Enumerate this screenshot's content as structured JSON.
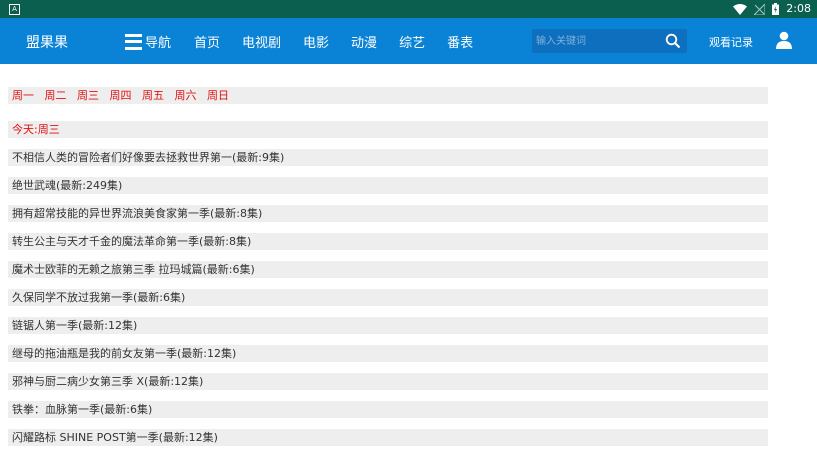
{
  "status_bar": {
    "app_indicator": "A",
    "time": "2:08"
  },
  "navbar": {
    "brand": "盟果果",
    "menu_label": "导航",
    "links": [
      "首页",
      "电视剧",
      "电影",
      "动漫",
      "综艺",
      "番表"
    ],
    "search_placeholder": "输入关键词",
    "history_label": "观看记录"
  },
  "colors": {
    "nav_bg": "#0a82d6",
    "status_bg": "#0b5f4f",
    "highlight": "#e01010",
    "row_bg": "#eeeeee"
  },
  "weekdays": [
    "周一",
    "周二",
    "周三",
    "周四",
    "周五",
    "周六",
    "周日"
  ],
  "today_label": "今天:周三",
  "items": [
    "不相信人类的冒险者们好像要去拯救世界第一(最新:9集)",
    "绝世武魂(最新:249集)",
    "拥有超常技能的异世界流浪美食家第一季(最新:8集)",
    "转生公主与天才千金的魔法革命第一季(最新:8集)",
    "魔术士欧菲的无赖之旅第三季 拉玛城篇(最新:6集)",
    "久保同学不放过我第一季(最新:6集)",
    "链锯人第一季(最新:12集)",
    "继母的拖油瓶是我的前女友第一季(最新:12集)",
    "邪神与厨二病少女第三季 X(最新:12集)",
    "铁拳：血脉第一季(最新:6集)",
    "闪耀路标 SHINE POST第一季(最新:12集)"
  ]
}
